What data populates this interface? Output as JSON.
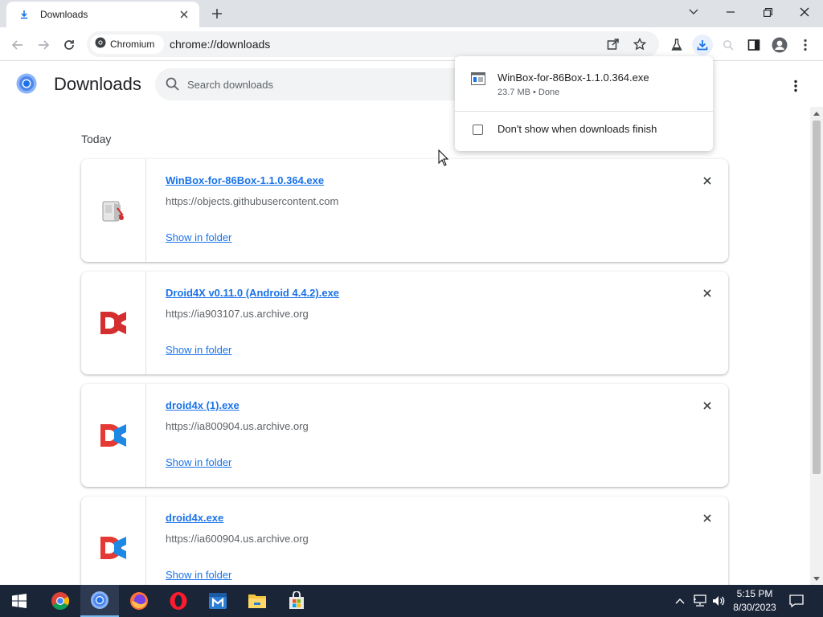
{
  "tab": {
    "title": "Downloads"
  },
  "toolbar": {
    "site_chip": "Chromium",
    "url": "chrome://downloads"
  },
  "page": {
    "title": "Downloads",
    "search_placeholder": "Search downloads",
    "section_label": "Today"
  },
  "downloads": [
    {
      "name": "WinBox-for-86Box-1.1.0.364.exe",
      "url": "https://objects.githubusercontent.com",
      "action": "Show in folder",
      "icon": "winbox-app-icon"
    },
    {
      "name": "Droid4X v0.11.0 (Android 4.4.2).exe",
      "url": "https://ia903107.us.archive.org",
      "action": "Show in folder",
      "icon": "droid4x-red-icon"
    },
    {
      "name": "droid4x (1).exe",
      "url": "https://ia800904.us.archive.org",
      "action": "Show in folder",
      "icon": "droid4x-icon"
    },
    {
      "name": "droid4x.exe",
      "url": "https://ia600904.us.archive.org",
      "action": "Show in folder",
      "icon": "droid4x-icon"
    }
  ],
  "bubble": {
    "file_name": "WinBox-for-86Box-1.1.0.364.exe",
    "status": "23.7 MB • Done",
    "checkbox_label": "Don't show when downloads finish"
  },
  "taskbar": {
    "time": "5:15 PM",
    "date": "8/30/2023"
  },
  "colors": {
    "accent": "#1a73e8",
    "tabstrip": "#dee1e6",
    "taskbar": "#1b2538"
  }
}
